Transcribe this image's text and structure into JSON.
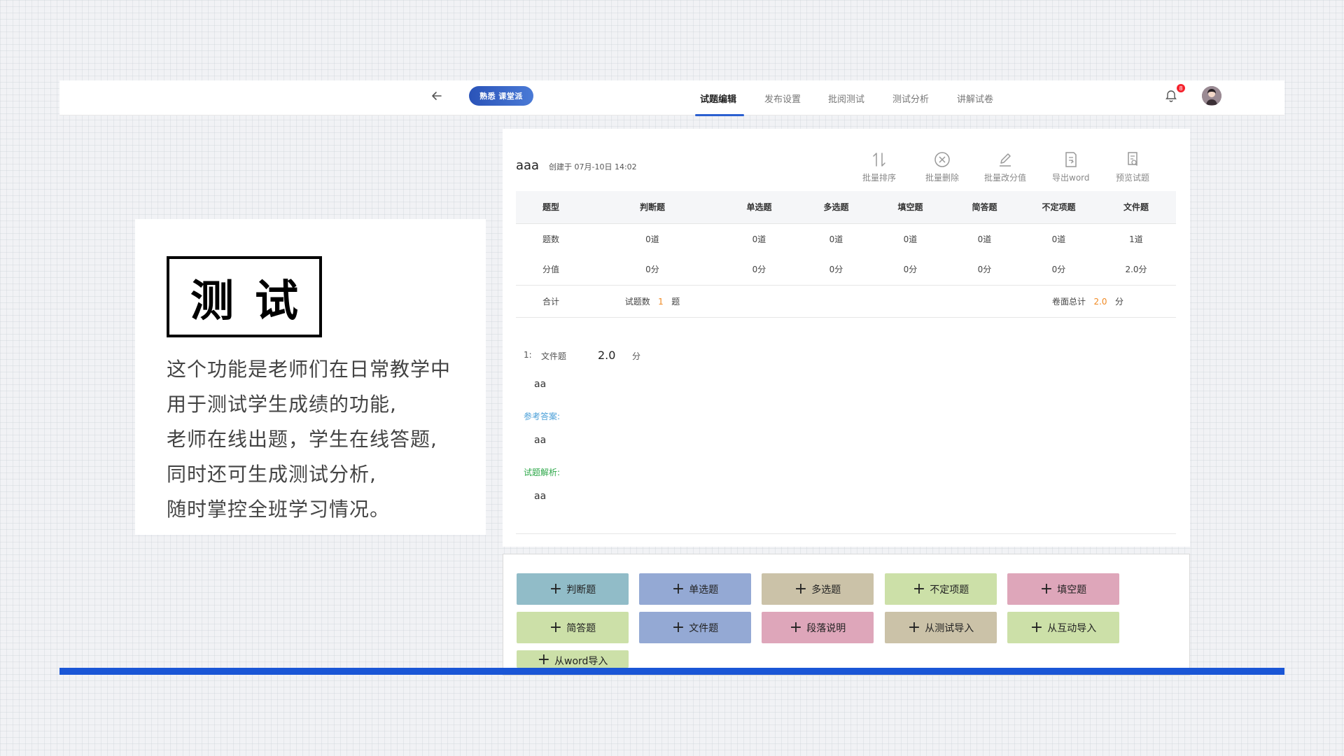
{
  "header": {
    "logo_text": "熟悉 课堂派",
    "nav": [
      {
        "label": "试题编辑",
        "active": true
      },
      {
        "label": "发布设置"
      },
      {
        "label": "批阅测试"
      },
      {
        "label": "测试分析"
      },
      {
        "label": "讲解试卷"
      }
    ],
    "bell_badge": "8",
    "icons": {
      "back": "arrow-left-icon",
      "bell": "bell-icon",
      "avatar": "user-avatar"
    }
  },
  "left_card": {
    "title": "测试",
    "lines": [
      "这个功能是老师们在日常教学中",
      "用于测试学生成绩的功能,",
      "老师在线出题，学生在线答题,",
      "同时还可生成测试分析,",
      "随时掌控全班学习情况。"
    ]
  },
  "paper": {
    "title": "aaa",
    "meta": "创建于 07月-10日 14:02"
  },
  "toolbar": [
    {
      "label": "批量排序",
      "icon": "sort-icon"
    },
    {
      "label": "批量删除",
      "icon": "delete-icon"
    },
    {
      "label": "批量改分值",
      "icon": "edit-icon"
    },
    {
      "label": "导出word",
      "icon": "export-icon"
    },
    {
      "label": "预览试题",
      "icon": "preview-icon"
    }
  ],
  "table": {
    "headers": [
      "题型",
      "判断题",
      "单选题",
      "多选题",
      "填空题",
      "简答题",
      "不定项题",
      "文件题"
    ],
    "count_row": [
      "题数",
      "0道",
      "0道",
      "0道",
      "0道",
      "0道",
      "0道",
      "1道"
    ],
    "score_row": [
      "分值",
      "0分",
      "0分",
      "0分",
      "0分",
      "0分",
      "0分",
      "2.0分"
    ],
    "total": {
      "label": "合计",
      "count_label": "试题数",
      "count_value": "1",
      "count_unit": "题",
      "score_label": "卷面总计",
      "score_value": "2.0",
      "score_unit": "分"
    }
  },
  "question": {
    "number": "1:",
    "type": "文件题",
    "score": "2.0",
    "score_unit": "分",
    "stem": "aa",
    "answer_label": "参考答案:",
    "answer": "aa",
    "analysis_label": "试题解析:",
    "analysis": "aa"
  },
  "add_buttons": [
    {
      "label": "判断题",
      "color": "#91bcc8"
    },
    {
      "label": "单选题",
      "color": "#94a9d4"
    },
    {
      "label": "多选题",
      "color": "#cbc2a8"
    },
    {
      "label": "不定项题",
      "color": "#cce0a8"
    },
    {
      "label": "填空题",
      "color": "#dea6ba"
    },
    {
      "label": "简答题",
      "color": "#cce0a8"
    },
    {
      "label": "文件题",
      "color": "#94a9d4"
    },
    {
      "label": "段落说明",
      "color": "#dea6ba"
    },
    {
      "label": "从测试导入",
      "color": "#cbc2a8"
    },
    {
      "label": "从互动导入",
      "color": "#cce0a8"
    },
    {
      "label": "从word导入",
      "color": "#cce0a8"
    }
  ],
  "plus_symbol": "+",
  "colors": {
    "accent": "#2b5fd0",
    "bottom_bar": "#1a56d6",
    "orange": "#f08a24"
  }
}
